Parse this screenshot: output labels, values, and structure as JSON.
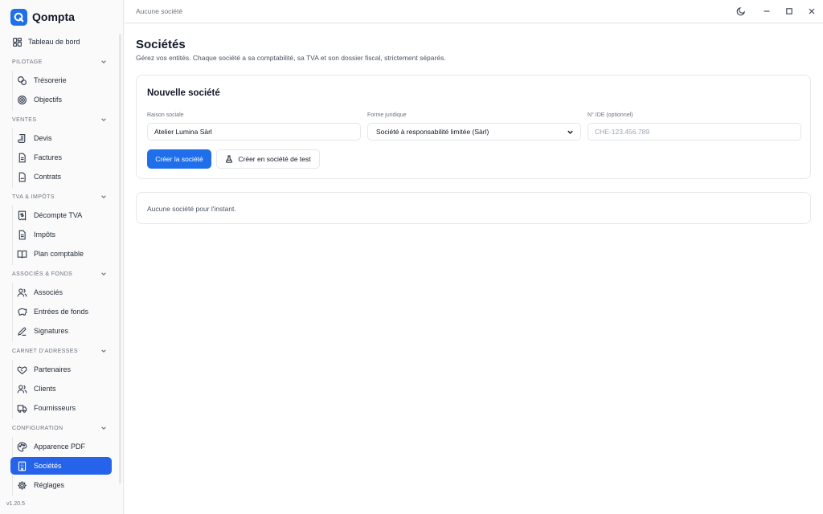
{
  "app": {
    "name": "Qompta",
    "version": "v1.20.5"
  },
  "topbar": {
    "breadcrumb": "Aucune société"
  },
  "sidebar": {
    "dashboard": "Tableau de bord",
    "sections": [
      {
        "label": "PILOTAGE",
        "items": [
          "Trésorerie",
          "Objectifs"
        ]
      },
      {
        "label": "VENTES",
        "items": [
          "Devis",
          "Factures",
          "Contrats"
        ]
      },
      {
        "label": "TVA & IMPÔTS",
        "items": [
          "Décompte TVA",
          "Impôts",
          "Plan comptable"
        ]
      },
      {
        "label": "ASSOCIÉS & FONDS",
        "items": [
          "Associés",
          "Entrées de fonds",
          "Signatures"
        ]
      },
      {
        "label": "CARNET D'ADRESSES",
        "items": [
          "Partenaires",
          "Clients",
          "Fournisseurs"
        ]
      },
      {
        "label": "CONFIGURATION",
        "items": [
          "Apparence PDF",
          "Sociétés",
          "Réglages"
        ]
      }
    ],
    "active_item": "Sociétés"
  },
  "page": {
    "title": "Sociétés",
    "subtitle": "Gérez vos entités. Chaque société a sa comptabilité, sa TVA et son dossier fiscal, strictement séparés."
  },
  "form": {
    "title": "Nouvelle société",
    "raison_sociale": {
      "label": "Raison sociale",
      "value": "Atelier Lumina Sàrl"
    },
    "forme_juridique": {
      "label": "Forme juridique",
      "value": "Société à responsabilité limitée (Sàrl)"
    },
    "ide": {
      "label": "N° IDE (optionnel)",
      "placeholder": "CHE-123.456.789"
    },
    "create_button": "Créer la société",
    "test_button": "Créer en société de test"
  },
  "list": {
    "empty_text": "Aucune société pour l'instant."
  },
  "colors": {
    "accent": "#2563eb",
    "border": "#e5e7eb",
    "muted": "#6b7280"
  }
}
